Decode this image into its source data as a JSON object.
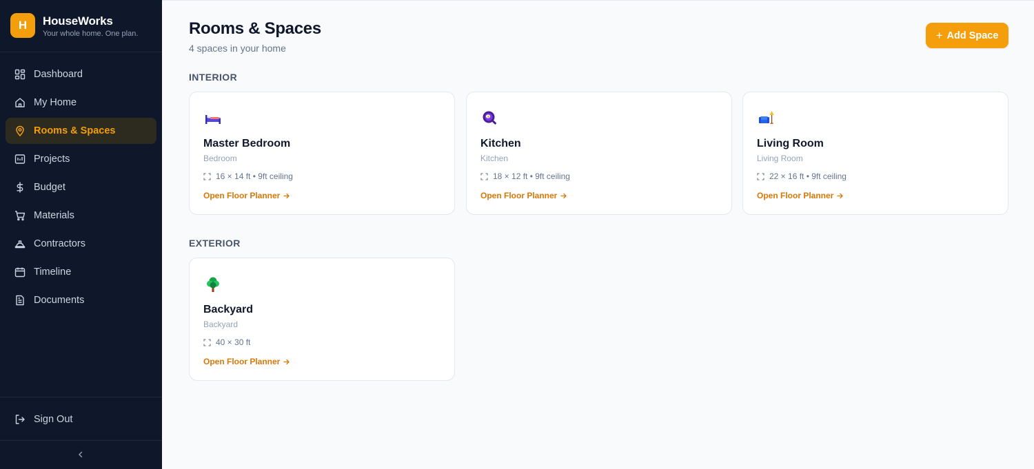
{
  "app": {
    "name": "HouseWorks",
    "tagline": "Your whole home. One plan.",
    "logo_letter": "H"
  },
  "colors": {
    "accent": "#f59e0b",
    "sidebar_bg": "#0f172a",
    "link": "#d97706"
  },
  "sidebar": {
    "items": [
      {
        "label": "Dashboard",
        "icon": "dashboard-icon"
      },
      {
        "label": "My Home",
        "icon": "home-icon"
      },
      {
        "label": "Rooms & Spaces",
        "icon": "map-pin-icon",
        "active": true
      },
      {
        "label": "Projects",
        "icon": "projects-icon"
      },
      {
        "label": "Budget",
        "icon": "dollar-icon"
      },
      {
        "label": "Materials",
        "icon": "cart-icon"
      },
      {
        "label": "Contractors",
        "icon": "hard-hat-icon"
      },
      {
        "label": "Timeline",
        "icon": "calendar-icon"
      },
      {
        "label": "Documents",
        "icon": "document-icon"
      }
    ],
    "sign_out": "Sign Out"
  },
  "page": {
    "title": "Rooms & Spaces",
    "subtitle": "4 spaces in your home",
    "add_button": "Add Space"
  },
  "sections": [
    {
      "label": "INTERIOR",
      "rooms": [
        {
          "name": "Master Bedroom",
          "type": "Bedroom",
          "dims": "16 × 14 ft",
          "ceiling": "• 9ft ceiling",
          "icon": "bed-icon",
          "link": "Open Floor Planner"
        },
        {
          "name": "Kitchen",
          "type": "Kitchen",
          "dims": "18 × 12 ft",
          "ceiling": "• 9ft ceiling",
          "icon": "frying-pan-icon",
          "link": "Open Floor Planner"
        },
        {
          "name": "Living Room",
          "type": "Living Room",
          "dims": "22 × 16 ft",
          "ceiling": "• 9ft ceiling",
          "icon": "couch-lamp-icon",
          "link": "Open Floor Planner"
        }
      ]
    },
    {
      "label": "EXTERIOR",
      "rooms": [
        {
          "name": "Backyard",
          "type": "Backyard",
          "dims": "40 × 30 ft",
          "ceiling": "",
          "icon": "tree-icon",
          "link": "Open Floor Planner"
        }
      ]
    }
  ]
}
